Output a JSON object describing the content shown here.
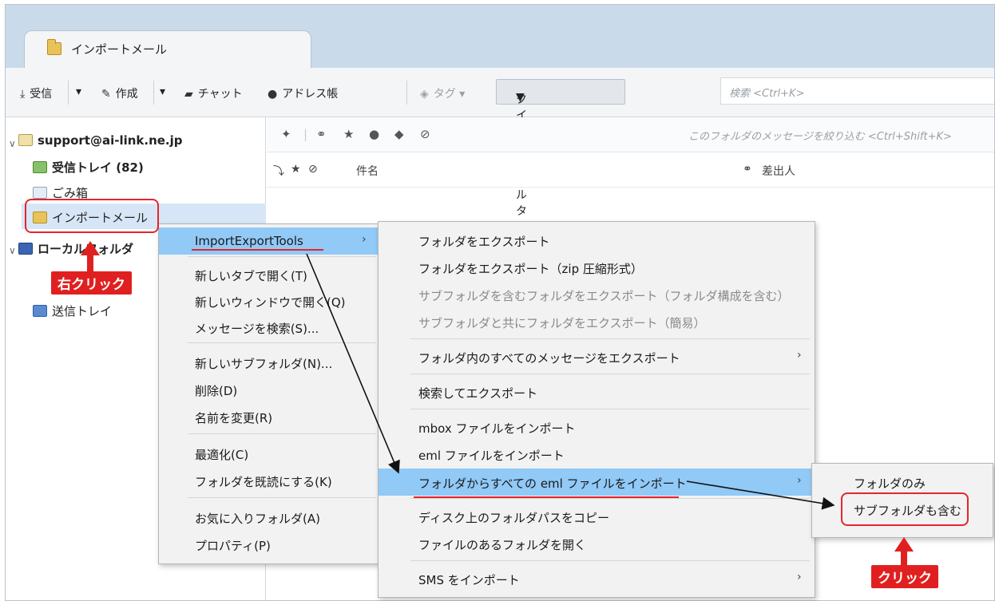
{
  "tab": {
    "label": "インポートメール"
  },
  "toolbar": {
    "receive": "受信",
    "compose": "作成",
    "chat": "チャット",
    "address_book": "アドレス帳",
    "tag": "タグ",
    "quick_filter": "クイックフィルタ",
    "search_placeholder": "検索 <Ctrl+K>"
  },
  "folders": {
    "account": "support@ai-link.ne.jp",
    "inbox": "受信トレイ (82)",
    "trash": "ごみ箱",
    "import_mail": "インポートメール",
    "local_folders": "ローカルフォルダ",
    "sent": "送信トレイ"
  },
  "message_filter_placeholder": "このフォルダのメッセージを絞り込む <Ctrl+Shift+K>",
  "columns": {
    "subject": "件名",
    "sender": "差出人"
  },
  "context_menu": {
    "importexport": "ImportExportTools",
    "open_new_tab": "新しいタブで開く(T)",
    "open_new_window": "新しいウィンドウで開く(Q)",
    "search_messages": "メッセージを検索(S)...",
    "new_subfolder": "新しいサブフォルダ(N)...",
    "delete": "削除(D)",
    "rename": "名前を変更(R)",
    "compact": "最適化(C)",
    "mark_read": "フォルダを既読にする(K)",
    "favorite": "お気に入りフォルダ(A)",
    "properties": "プロパティ(P)"
  },
  "submenu": {
    "export_folder": "フォルダをエクスポート",
    "export_folder_zip": "フォルダをエクスポート（zip 圧縮形式）",
    "export_with_subfolders": "サブフォルダを含むフォルダをエクスポート（フォルダ構成を含む）",
    "export_with_subfolders_simple": "サブフォルダと共にフォルダをエクスポート（簡易）",
    "export_all_messages": "フォルダ内のすべてのメッセージをエクスポート",
    "search_export": "検索してエクスポート",
    "import_mbox": "mbox ファイルをインポート",
    "import_eml": "eml ファイルをインポート",
    "import_all_eml": "フォルダからすべての eml ファイルをインポート",
    "copy_folder_path": "ディスク上のフォルダパスをコピー",
    "open_folder": "ファイルのあるフォルダを開く",
    "import_sms": "SMS をインポート"
  },
  "submenu2": {
    "folder_only": "フォルダのみ",
    "include_subfolders": "サブフォルダも含む"
  },
  "annotations": {
    "right_click": "右クリック",
    "click": "クリック"
  }
}
